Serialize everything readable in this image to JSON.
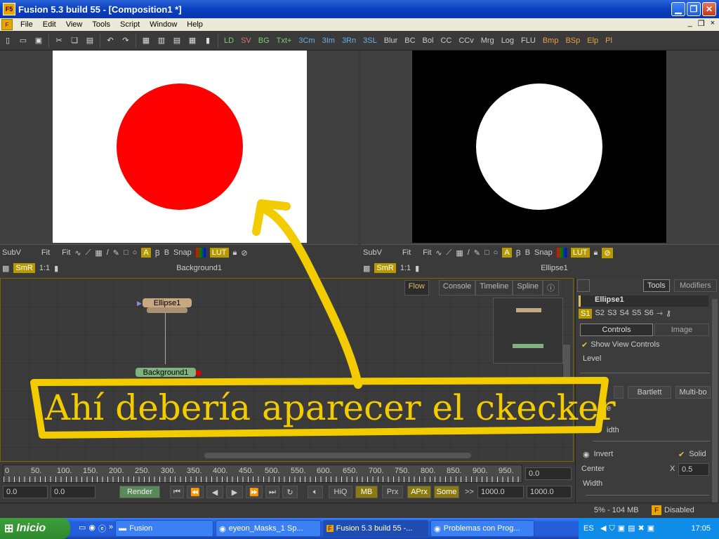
{
  "window": {
    "title": "Fusion 5.3 build 55 - [Composition1 *]",
    "logo": "F5"
  },
  "menu": [
    "File",
    "Edit",
    "View",
    "Tools",
    "Script",
    "Window",
    "Help"
  ],
  "toolbar": {
    "tools": [
      "LD",
      "SV",
      "BG",
      "Txt+",
      "3Cm",
      "3Im",
      "3Rn",
      "3SL",
      "Blur",
      "BC",
      "Bol",
      "CC",
      "CCv",
      "Mrg",
      "Log",
      "FLU",
      "Bmp",
      "BSp",
      "Elp",
      "Pl"
    ]
  },
  "viewer_left": {
    "row1": [
      "SubV",
      "Fit",
      "Fit",
      "Snap",
      "LUT"
    ],
    "smr": "SmR",
    "ratio": "1:1",
    "title": "Background1"
  },
  "viewer_right": {
    "row1": [
      "SubV",
      "Fit",
      "Fit",
      "Snap",
      "LUT"
    ],
    "smr": "SmR",
    "ratio": "1:1",
    "title": "Ellipse1"
  },
  "flow": {
    "tabs": [
      "Flow",
      "Console",
      "Timeline",
      "Spline"
    ],
    "nodes": [
      "Ellipse1",
      "Background1"
    ]
  },
  "right_panel": {
    "tabs": [
      "Tools",
      "Modifiers"
    ],
    "node_name": "Ellipse1",
    "scripts": [
      "S1",
      "S2",
      "S3",
      "S4",
      "S5",
      "S6"
    ],
    "subtabs": [
      "Controls",
      "Image"
    ],
    "show_view_controls": "Show View Controls",
    "level": "Level",
    "filters": [
      "Bartlett",
      "Multi-bo"
    ],
    "partial1": "e",
    "partial2": "idth",
    "invert": "Invert",
    "solid": "Solid",
    "center": "Center",
    "x_label": "X",
    "x_value": "0.5",
    "width": "Width"
  },
  "timeline": {
    "ticks": [
      "0",
      "50.",
      "100.",
      "150.",
      "200.",
      "250.",
      "300.",
      "350.",
      "400.",
      "450.",
      "500.",
      "550.",
      "600.",
      "650.",
      "700.",
      "750.",
      "800.",
      "850.",
      "900.",
      "950."
    ],
    "current": "0.0",
    "start": "0.0",
    "start2": "0.0",
    "render": "Render",
    "buttons": [
      "HiQ",
      "MB",
      "Prx",
      "APrx",
      "Some"
    ],
    "end1": "1000.0",
    "end2": "1000.0",
    "arrow": ">>"
  },
  "status": {
    "mem": "5% - 104 MB",
    "disabled": "Disabled"
  },
  "annotation": "Ahí debería aparecer el ckecker",
  "taskbar": {
    "start": "Inicio",
    "tasks": [
      "Fusion",
      "eyeon_Masks_1 Sp...",
      "Fusion 5.3 build 55 -...",
      "Problemas con Prog..."
    ],
    "lang": "ES",
    "clock": "17:05"
  },
  "colors": {
    "accent_yellow": "#f3cc00",
    "red_circle": "#ff0000",
    "node_ellipse": "#c8a882",
    "node_bg": "#7fb27f"
  }
}
